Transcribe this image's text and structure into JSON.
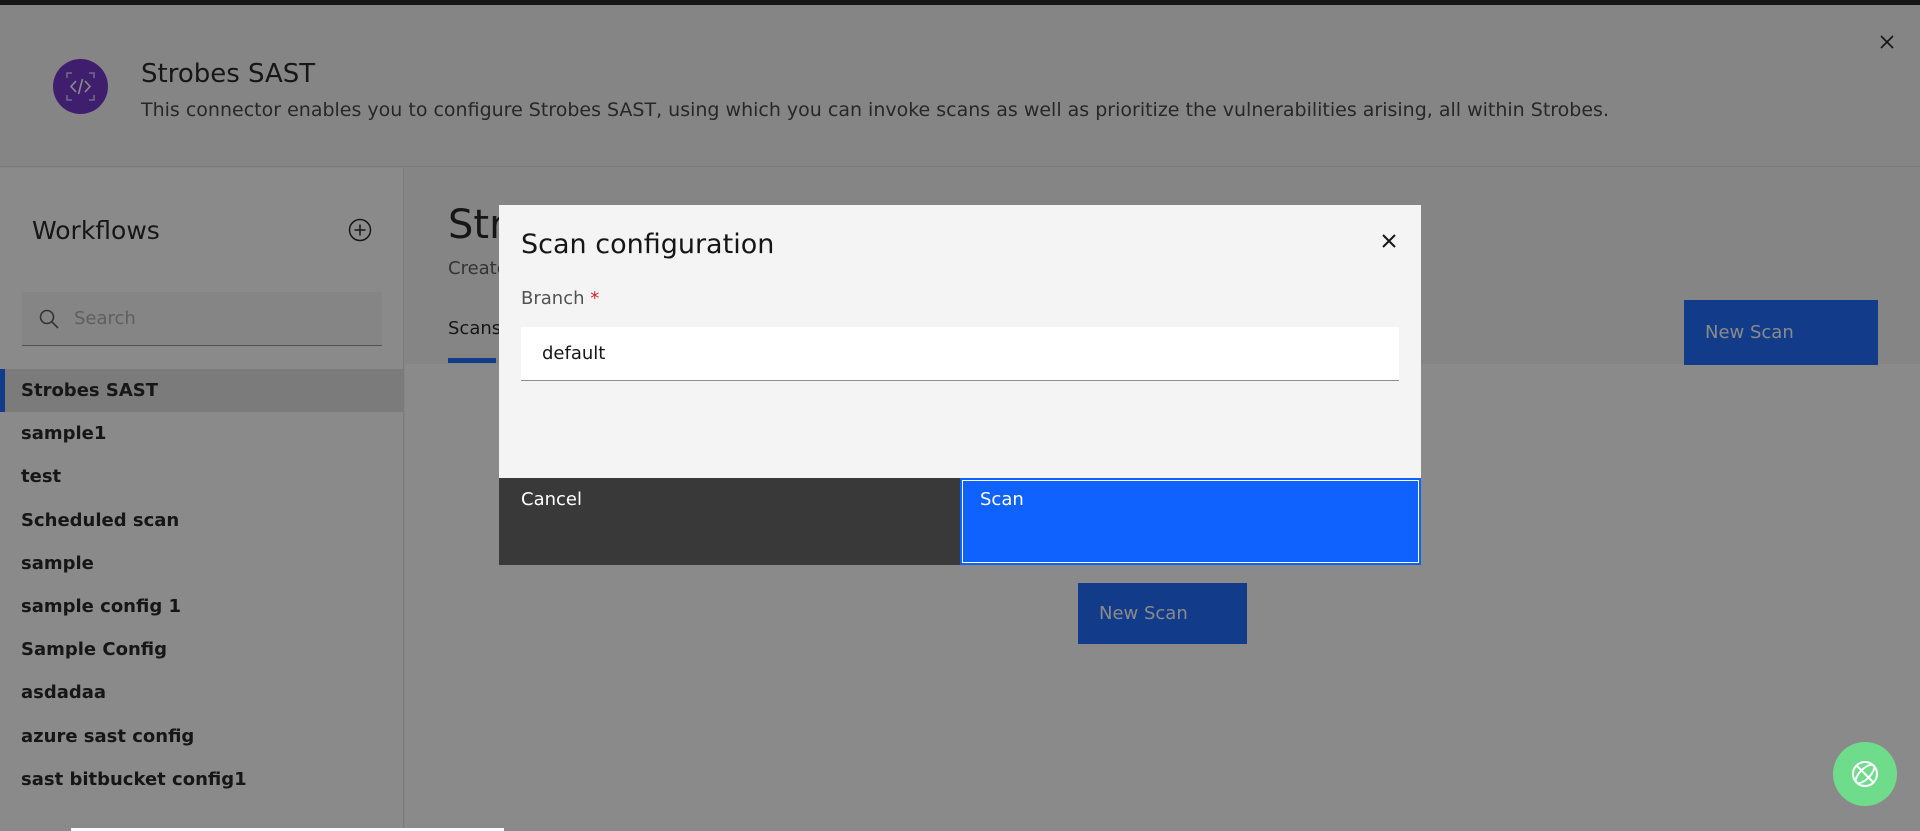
{
  "header": {
    "title": "Strobes SAST",
    "description": "This connector enables you to configure Strobes SAST, using which you can invoke scans as well as prioritize the vulnerabilities arising, all within Strobes."
  },
  "sidebar": {
    "title": "Workflows",
    "search_placeholder": "Search",
    "items": [
      {
        "label": "Strobes SAST"
      },
      {
        "label": "sample1"
      },
      {
        "label": "test"
      },
      {
        "label": "Scheduled scan"
      },
      {
        "label": "sample"
      },
      {
        "label": "sample config 1"
      },
      {
        "label": "Sample Config"
      },
      {
        "label": "asdadaa"
      },
      {
        "label": "azure sast config"
      },
      {
        "label": "sast bitbucket config1"
      }
    ]
  },
  "main": {
    "title": "Str",
    "subtitle": "Create",
    "tab": "Scans",
    "new_scan_top": "New Scan",
    "new_scan_mid": "New Scan"
  },
  "modal": {
    "title": "Scan configuration",
    "field_label": "Branch",
    "required_mark": "*",
    "field_value": "default",
    "cancel_label": "Cancel",
    "scan_label": "Scan"
  },
  "colors": {
    "primary": "#0f62fe",
    "logo": "#6929c4",
    "help_fab": "#6fdc8c"
  }
}
